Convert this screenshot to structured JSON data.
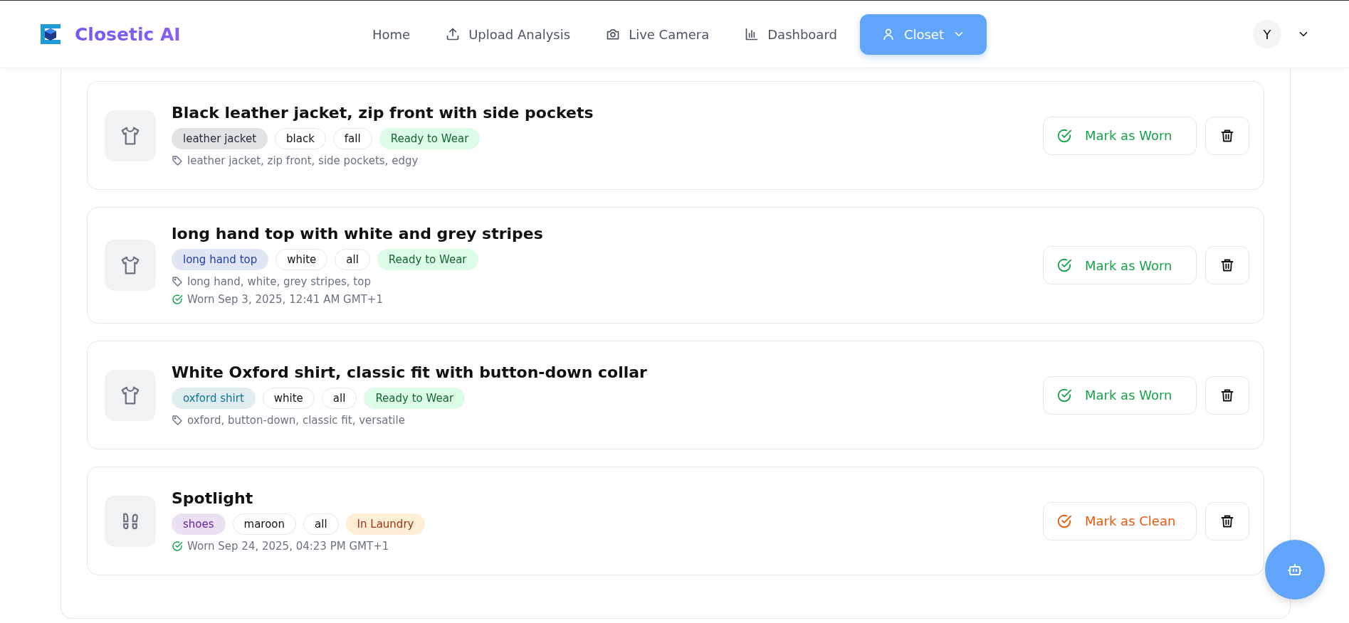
{
  "brand": {
    "name": "Closetic AI"
  },
  "nav": [
    {
      "label": "Home",
      "selected": false
    },
    {
      "label": "Upload Analysis",
      "selected": false
    },
    {
      "label": "Live Camera",
      "selected": false
    },
    {
      "label": "Dashboard",
      "selected": false
    },
    {
      "label": "Closet",
      "selected": true
    }
  ],
  "user": {
    "initial": "Y"
  },
  "items": [
    {
      "kind": "shirt",
      "title": "Black leather jacket, zip front with side pockets",
      "tags": [
        {
          "label": "leather jacket",
          "kind": "category",
          "color": "#1f2937"
        },
        {
          "label": "black",
          "kind": "plain"
        },
        {
          "label": "fall",
          "kind": "plain"
        },
        {
          "label": "Ready to Wear",
          "kind": "ready"
        }
      ],
      "keywords": "leather jacket, zip front, side pockets, edgy",
      "action": {
        "label": "Mark as Worn",
        "kind": "worn"
      }
    },
    {
      "kind": "shirt",
      "title": "long hand top with white and grey stripes",
      "tags": [
        {
          "label": "long hand top",
          "kind": "category",
          "color": "#1e40af"
        },
        {
          "label": "white",
          "kind": "plain"
        },
        {
          "label": "all",
          "kind": "plain"
        },
        {
          "label": "Ready to Wear",
          "kind": "ready"
        }
      ],
      "keywords": "long hand, white, grey stripes, top",
      "worn": "Worn Sep 3, 2025, 12:41 AM GMT+1",
      "action": {
        "label": "Mark as Worn",
        "kind": "worn"
      }
    },
    {
      "kind": "shirt",
      "title": "White Oxford shirt, classic fit with button-down collar",
      "tags": [
        {
          "label": "oxford shirt",
          "kind": "category",
          "color": "#0e7490"
        },
        {
          "label": "white",
          "kind": "plain"
        },
        {
          "label": "all",
          "kind": "plain"
        },
        {
          "label": "Ready to Wear",
          "kind": "ready"
        }
      ],
      "keywords": "oxford, button-down, classic fit, versatile",
      "action": {
        "label": "Mark as Worn",
        "kind": "worn"
      }
    },
    {
      "kind": "shoes",
      "title": "Spotlight",
      "tags": [
        {
          "label": "shoes",
          "kind": "category",
          "color": "#6b21a8"
        },
        {
          "label": "maroon",
          "kind": "plain"
        },
        {
          "label": "all",
          "kind": "plain"
        },
        {
          "label": "In Laundry",
          "kind": "laundry"
        }
      ],
      "worn": "Worn Sep 24, 2025, 04:23 PM GMT+1",
      "action": {
        "label": "Mark as Clean",
        "kind": "clean"
      }
    }
  ]
}
